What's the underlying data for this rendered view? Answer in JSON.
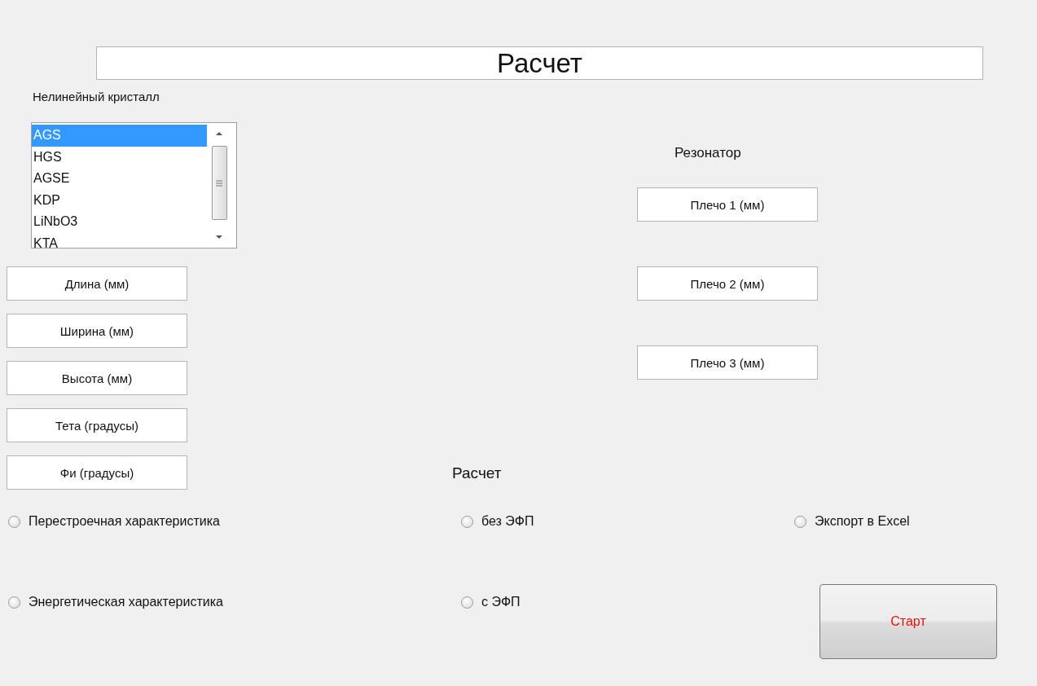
{
  "title": "Расчет",
  "crystal": {
    "label": "Нелинейный кристалл",
    "items": [
      {
        "label": "AGS",
        "selected": true
      },
      {
        "label": "HGS",
        "selected": false
      },
      {
        "label": "AGSE",
        "selected": false
      },
      {
        "label": "KDP",
        "selected": false
      },
      {
        "label": "LiNbO3",
        "selected": false
      },
      {
        "label": "KTA",
        "selected": false
      }
    ]
  },
  "crystal_fields": [
    {
      "value": "Длина (мм)"
    },
    {
      "value": "Ширина (мм)"
    },
    {
      "value": "Высота (мм)"
    },
    {
      "value": "Тета (градусы)"
    },
    {
      "value": "Фи (градусы)"
    }
  ],
  "resonator": {
    "label": "Резонатор",
    "fields": [
      {
        "value": "Плечо 1 (мм)"
      },
      {
        "value": "Плечо 2 (мм)"
      },
      {
        "value": "Плечо 3 (мм)"
      }
    ]
  },
  "calc_label": "Расчет",
  "radio_groups": [
    {
      "options": [
        {
          "label": "Перестроечная характеристика",
          "selected": false
        },
        {
          "label": "Энергетическая характеристика",
          "selected": false
        }
      ]
    },
    {
      "options": [
        {
          "label": "без ЭФП",
          "selected": false
        },
        {
          "label": "с ЭФП",
          "selected": false
        }
      ]
    },
    {
      "options": [
        {
          "label": "Экспорт в Excel",
          "selected": false
        }
      ]
    }
  ],
  "start_button": "Старт"
}
